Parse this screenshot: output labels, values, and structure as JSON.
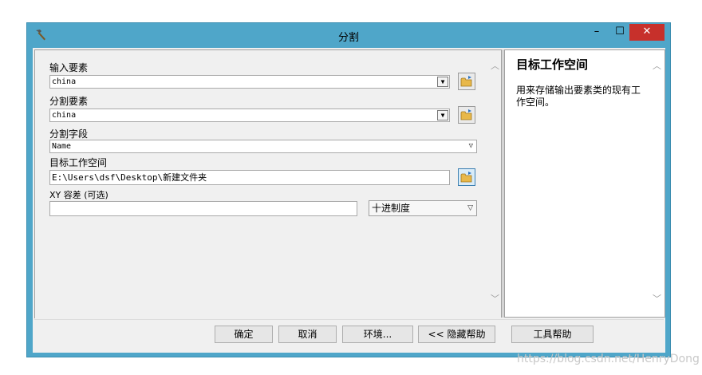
{
  "window": {
    "title": "分割"
  },
  "controls": {
    "minimize": "–",
    "maximize": "☐",
    "close": "✕"
  },
  "form": {
    "input_features": {
      "label": "输入要素",
      "value": "china"
    },
    "split_features": {
      "label": "分割要素",
      "value": "china"
    },
    "split_field": {
      "label": "分割字段",
      "value": "Name"
    },
    "target_workspace": {
      "label": "目标工作空间",
      "value": "E:\\Users\\dsf\\Desktop\\新建文件夹"
    },
    "xy_tolerance": {
      "label": "XY 容差 (可选)",
      "value": "",
      "unit": "十进制度"
    }
  },
  "help": {
    "title": "目标工作空间",
    "text": "用来存储输出要素类的现有工作空间。"
  },
  "buttons": {
    "ok": "确定",
    "cancel": "取消",
    "environments": "环境...",
    "hide_help": "<< 隐藏帮助",
    "tool_help": "工具帮助"
  },
  "watermark": "https://blog.csdn.net/HenryDong",
  "colors": {
    "titlebar": "#4fa6c9",
    "close": "#c7302b"
  },
  "icons": {
    "app": "hammer-icon",
    "browse": "folder-icon"
  }
}
